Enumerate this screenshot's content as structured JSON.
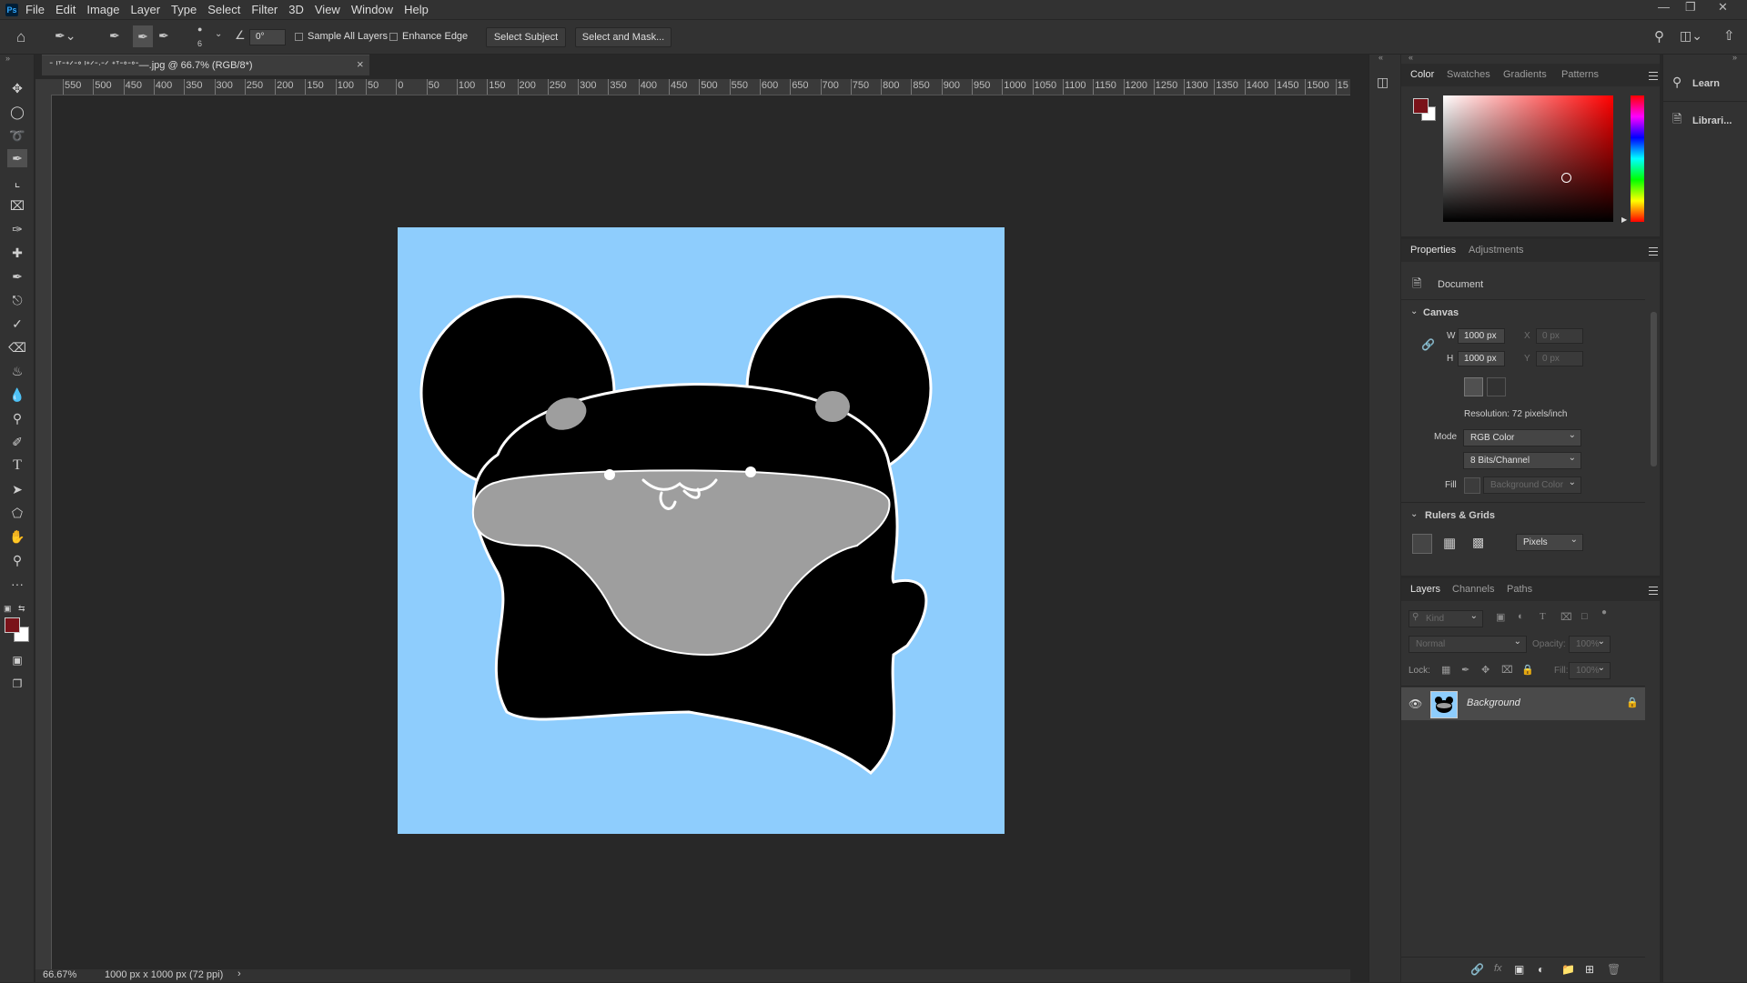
{
  "app": {
    "logo": "Ps"
  },
  "menu": [
    "File",
    "Edit",
    "Image",
    "Layer",
    "Type",
    "Select",
    "Filter",
    "3D",
    "View",
    "Window",
    "Help"
  ],
  "options_bar": {
    "brush_size": "6",
    "angle": "0°",
    "sample_all_layers": "Sample All Layers",
    "enhance_edge": "Enhance Edge",
    "select_subject": "Select Subject",
    "select_and_mask": "Select and Mask..."
  },
  "document": {
    "tab_title": "ᐨ ᑊᐪᐨᐩᐟᐨᐤ ᑊᐩᐟᐨᐧᐨᐟ ᐩᐪᐨᐤᐨᐤᐨ—.jpg @ 66.7% (RGB/8*)",
    "close": "×",
    "canvas_color": "#8ecdfd"
  },
  "ruler": {
    "h_labels": [
      "550",
      "500",
      "450",
      "400",
      "350",
      "300",
      "250",
      "200",
      "150",
      "100",
      "50",
      "0",
      "50",
      "100",
      "150",
      "200",
      "250",
      "300",
      "350",
      "400",
      "450",
      "500",
      "550",
      "600",
      "650",
      "700",
      "750",
      "800",
      "850",
      "900",
      "950",
      "1000",
      "1050",
      "1100",
      "1150",
      "1200",
      "1250",
      "1300",
      "1350",
      "1400",
      "1450",
      "1500",
      "15"
    ]
  },
  "status": {
    "zoom": "66.67%",
    "doc_info": "1000 px x 1000 px (72 ppi)",
    "arrow": "›"
  },
  "colors": {
    "foreground": "#7a1219",
    "background": "#ffffff",
    "accent_bg": "#323232"
  },
  "color_panel": {
    "tabs": [
      "Color",
      "Swatches",
      "Gradients",
      "Patterns"
    ],
    "active": "Color"
  },
  "properties_panel": {
    "tabs": [
      "Properties",
      "Adjustments"
    ],
    "doc_label": "Document",
    "canvas_title": "Canvas",
    "w_label": "W",
    "w_value": "1000 px",
    "h_label": "H",
    "h_value": "1000 px",
    "x_label": "X",
    "x_placeholder": "0 px",
    "y_label": "Y",
    "y_placeholder": "0 px",
    "resolution": "Resolution: 72 pixels/inch",
    "mode_label": "Mode",
    "mode_value": "RGB Color",
    "bits_value": "8 Bits/Channel",
    "fill_label": "Fill",
    "fill_value": "Background Color",
    "rulers_title": "Rulers & Grids",
    "units_value": "Pixels"
  },
  "layers_panel": {
    "tabs": [
      "Layers",
      "Channels",
      "Paths"
    ],
    "kind_placeholder": "Kind",
    "blend_mode": "Normal",
    "opacity_label": "Opacity:",
    "opacity_value": "100%",
    "lock_label": "Lock:",
    "fill_label": "Fill:",
    "fill_value": "100%",
    "layers": [
      {
        "name": "Background",
        "visible": true,
        "locked": true
      }
    ]
  },
  "learn_panel": {
    "items": [
      "Learn",
      "Librari..."
    ]
  }
}
